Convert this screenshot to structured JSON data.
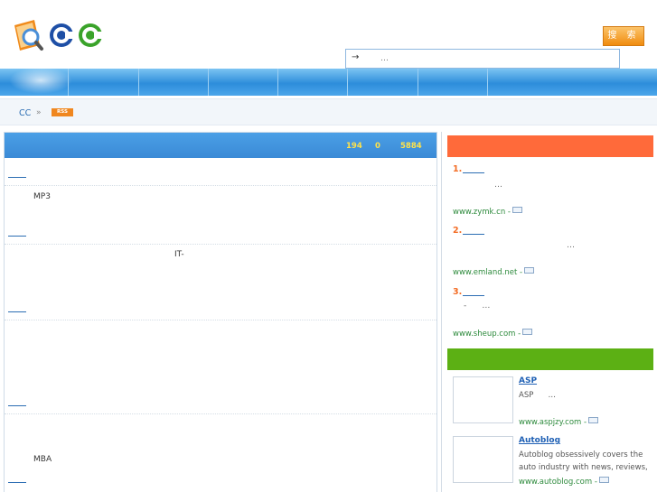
{
  "header": {
    "search_button": "搜 索",
    "search_arrow": "→",
    "search_placeholder": "…"
  },
  "breadcrumb": {
    "home": "CC",
    "sep": "»",
    "rss": "RSS"
  },
  "main": {
    "stats": [
      "194",
      "0",
      "5884"
    ],
    "rows": [
      {
        "text": ""
      },
      {
        "text": "MP3"
      },
      {
        "text": "IT-"
      },
      {
        "text": ""
      },
      {
        "text": "MBA"
      }
    ]
  },
  "side": {
    "ranking": [
      {
        "num": "1.",
        "desc": "…",
        "url": "www.zymk.cn -"
      },
      {
        "num": "2.",
        "desc": "…",
        "url": "www.emland.net -"
      },
      {
        "num": "3.",
        "desc": "-      …",
        "url": "www.sheup.com -"
      }
    ],
    "sites": [
      {
        "title": "ASP",
        "desc": "ASP      …",
        "url": "www.aspjzy.com -"
      },
      {
        "title": "Autoblog",
        "desc": "Autoblog obsessively covers the auto industry with news, reviews,",
        "url": "www.autoblog.com -"
      }
    ]
  },
  "colors": {
    "nav": "#2d8ddb",
    "main_head": "#4a9fe6",
    "side_head_1": "#ff6a3a",
    "side_head_2": "#5cb014",
    "accent": "#f36c24"
  }
}
